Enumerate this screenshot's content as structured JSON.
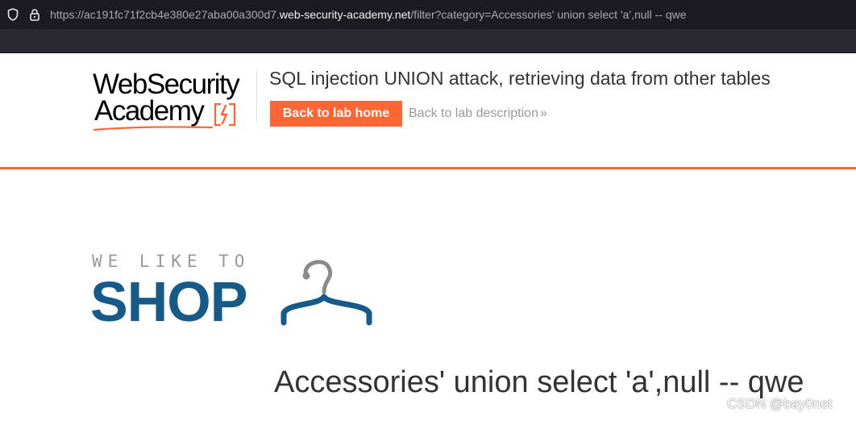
{
  "browser": {
    "url_prefix": "https://ac191fc71f2cb4e380e27aba00a300d7.",
    "url_host": "web-security-academy.net",
    "url_suffix": "/filter?category=Accessories' union select 'a',null -- qwe"
  },
  "header": {
    "logo_line1": "WebSecurity",
    "logo_line2": "Academy",
    "lab_title": "SQL injection UNION attack, retrieving data from other tables",
    "back_home_label": "Back to lab home",
    "back_description_label": "Back to lab description",
    "back_description_chevron": "»"
  },
  "shop": {
    "tagline": "WE LIKE TO",
    "brand": "SHOP"
  },
  "category_heading": "Accessories' union select 'a',null -- qwe",
  "watermark": "CSDN @bay0net",
  "colors": {
    "accent": "#ff6633",
    "shop_blue": "#165a8a",
    "title_text": "#333333"
  },
  "icons": [
    "shield-icon",
    "lock-icon",
    "hanger-icon"
  ]
}
